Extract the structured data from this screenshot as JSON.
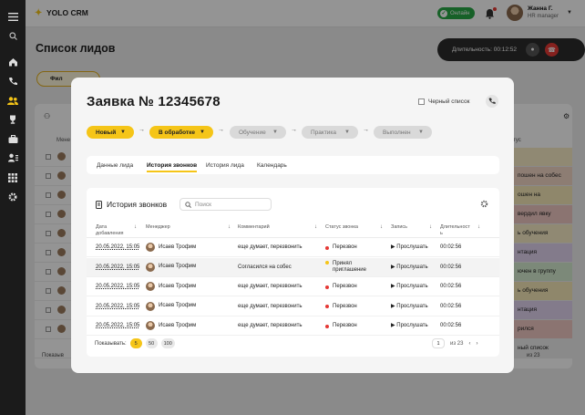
{
  "app": {
    "title": "YOLO CRM",
    "status": "Онлайн"
  },
  "user": {
    "name": "Жанна Г.",
    "role": "HR manager"
  },
  "page": {
    "title": "Список лидов",
    "filter_label": "Фил"
  },
  "call": {
    "duration_label": "Длительность: 00:12:52"
  },
  "background": {
    "right_cells": [
      "",
      "пошен на собес",
      "ошен на",
      "вердил явку",
      "ь обучения",
      "нтация",
      "ючен в группу",
      "ь обучения",
      "нтация",
      "рился",
      "ный список"
    ],
    "right_colors": [
      "#f8edc7",
      "#f3d7c7",
      "#f6e9b8",
      "#f0c8c3",
      "#f8edc7",
      "#e2d4f0",
      "#d6ecd0",
      "#f6e9b8",
      "#e2d4f0",
      "#f0c8c3",
      "#eeeeee"
    ],
    "header_left": "Мене",
    "header_right": "тус",
    "footer": "Показыв",
    "pagination": "из 23"
  },
  "modal": {
    "title": "Заявка № 12345678",
    "blacklist_label": "Черный список",
    "stages": [
      "Новый",
      "В обработке",
      "Обучение",
      "Практика",
      "Выполнен"
    ],
    "tabs": [
      "Данные лида",
      "История звонков",
      "История лида",
      "Календарь"
    ]
  },
  "calls": {
    "title": "История звонков",
    "search_placeholder": "Поиск",
    "headers": {
      "date": "Дата добавления",
      "manager": "Менеджер",
      "comment": "Комментарий",
      "status": "Статус звонка",
      "record": "Запись",
      "duration": "Длительность"
    },
    "rows": [
      {
        "date": "20.05.2022, 15:05",
        "manager": "Исаев Трофим",
        "comment": "еще думает, перезвонить",
        "status": "Перезвон",
        "status_color": "#e53935",
        "record": "Прослушать",
        "duration": "00:02:56"
      },
      {
        "date": "20.05.2022, 15:05",
        "manager": "Исаев Трофим",
        "comment": "Согласился на собес",
        "status": "Принял приглашение",
        "status_color": "#f5c518",
        "record": "Прослушать",
        "duration": "00:02:56"
      },
      {
        "date": "20.05.2022, 15:05",
        "manager": "Исаев Трофим",
        "comment": "еще думает, перезвонить",
        "status": "Перезвон",
        "status_color": "#e53935",
        "record": "Прослушать",
        "duration": "00:02:56"
      },
      {
        "date": "20.05.2022, 15:05",
        "manager": "Исаев Трофим",
        "comment": "еще думает, перезвонить",
        "status": "Перезвон",
        "status_color": "#e53935",
        "record": "Прослушать",
        "duration": "00:02:56"
      },
      {
        "date": "20.05.2022, 15:05",
        "manager": "Исаев Трофим",
        "comment": "еще думает, перезвонить",
        "status": "Перезвон",
        "status_color": "#e53935",
        "record": "Прослушать",
        "duration": "00:02:56"
      }
    ],
    "footer": {
      "show_label": "Показывать:",
      "sizes": [
        "5",
        "50",
        "100"
      ],
      "current_page": "1",
      "of_pages": "из 23"
    }
  },
  "colors": {
    "accent": "#f5c518",
    "online": "#29a745",
    "danger": "#e53935"
  }
}
